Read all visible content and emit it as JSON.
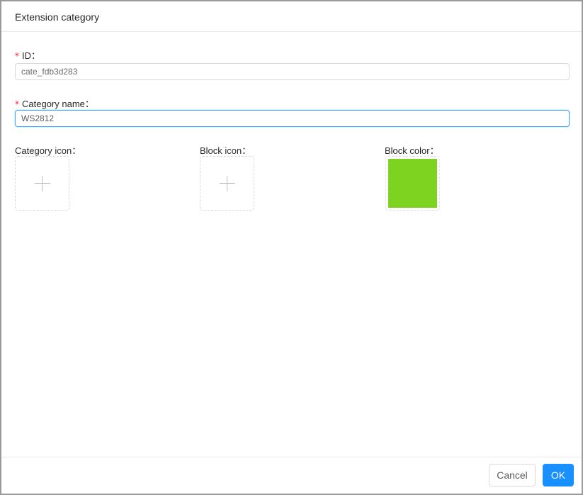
{
  "dialog": {
    "title": "Extension category"
  },
  "form": {
    "id": {
      "required_mark": "*",
      "label": "ID：",
      "value": "cate_fdb3d283"
    },
    "category_name": {
      "required_mark": "*",
      "label": "Category name：",
      "value": "WS2812"
    },
    "category_icon": {
      "label": "Category icon：",
      "icon": "plus-icon"
    },
    "block_icon": {
      "label": "Block icon：",
      "icon": "plus-icon"
    },
    "block_color": {
      "label": "Block color：",
      "value": "#7ed321"
    }
  },
  "footer": {
    "cancel_label": "Cancel",
    "ok_label": "OK"
  },
  "colors": {
    "primary": "#1890ff",
    "required": "#f5222d",
    "block_color": "#7ed321"
  }
}
